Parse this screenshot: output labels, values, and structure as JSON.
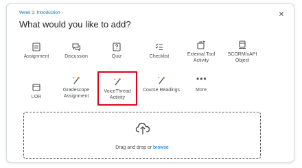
{
  "breadcrumb": {
    "label": "Week 1: Introduction"
  },
  "dialog": {
    "title": "What would you like to add?",
    "close_icon": "close-icon"
  },
  "tiles_row1": [
    {
      "label": "Assignment",
      "icon": "assignment-icon"
    },
    {
      "label": "Discussion",
      "icon": "discussion-icon"
    },
    {
      "label": "Quiz",
      "icon": "quiz-icon"
    },
    {
      "label": "Checklist",
      "icon": "checklist-icon"
    },
    {
      "label": "External Tool Activity",
      "icon": "external-tool-icon"
    },
    {
      "label": "SCORM/xAPI Object",
      "icon": "scorm-icon"
    }
  ],
  "tiles_row2": [
    {
      "label": "LOR",
      "icon": "lor-icon"
    },
    {
      "label": "Gradescope Assignment",
      "icon": "gradescope-icon"
    },
    {
      "label": "VoiceThread Activity",
      "icon": "voicethread-icon",
      "highlight_color": "#e0001b"
    },
    {
      "label": "Course Readings",
      "icon": "course-readings-icon"
    },
    {
      "label": "More",
      "icon": "more-icon"
    }
  ],
  "dropzone": {
    "text": "Drag and drop or",
    "browse": "browse",
    "icon": "upload-cloud-icon"
  },
  "colors": {
    "link": "#006fbf",
    "text": "#494c4e",
    "highlight": "#e0001b"
  }
}
